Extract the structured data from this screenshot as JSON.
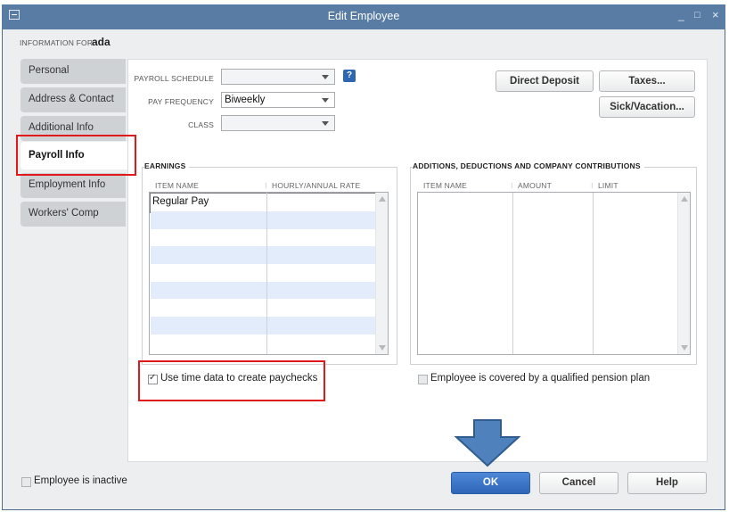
{
  "window": {
    "title": "Edit Employee",
    "buttons": [
      "_",
      "□",
      "×"
    ]
  },
  "info_for": {
    "label": "INFORMATION FOR",
    "name": "ada"
  },
  "tabs": [
    {
      "label": "Personal"
    },
    {
      "label": "Address & Contact"
    },
    {
      "label": "Additional Info"
    },
    {
      "label": "Payroll Info",
      "selected": true
    },
    {
      "label": "Employment Info"
    },
    {
      "label": "Workers' Comp"
    }
  ],
  "fields": {
    "payroll_schedule": {
      "label": "PAYROLL SCHEDULE",
      "value": ""
    },
    "pay_frequency": {
      "label": "PAY FREQUENCY",
      "value": "Biweekly"
    },
    "class": {
      "label": "CLASS",
      "value": ""
    },
    "help_icon": "?"
  },
  "buttons": {
    "direct_deposit": "Direct Deposit",
    "taxes": "Taxes...",
    "sick_vacation": "Sick/Vacation...",
    "ok": "OK",
    "cancel": "Cancel",
    "help": "Help"
  },
  "earnings": {
    "title": "EARNINGS",
    "columns": [
      "ITEM NAME",
      "HOURLY/ANNUAL RATE"
    ],
    "rows": [
      [
        "Regular Pay",
        ""
      ]
    ]
  },
  "additions": {
    "title": "ADDITIONS, DEDUCTIONS AND COMPANY CONTRIBUTIONS",
    "columns": [
      "ITEM NAME",
      "AMOUNT",
      "LIMIT"
    ],
    "rows": []
  },
  "checkboxes": {
    "use_time_data": {
      "label": "Use time data to create paychecks",
      "checked": true
    },
    "pension": {
      "label": "Employee is covered by a qualified pension plan",
      "checked": false
    },
    "inactive": {
      "label": "Employee is inactive",
      "checked": false
    }
  },
  "colors": {
    "titlebar": "#587ca4",
    "highlight": "#e0191a",
    "arrow": "#4f81bd",
    "ok_button": "#3a73c4"
  },
  "icons": {
    "system_menu": "window-menu-icon",
    "arrow": "down-arrow-icon"
  }
}
